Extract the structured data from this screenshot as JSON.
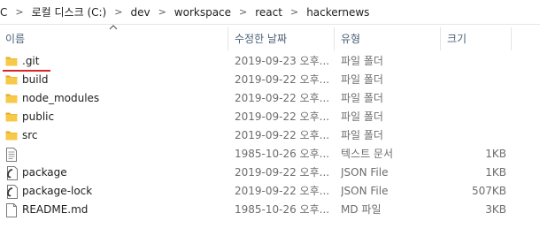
{
  "breadcrumb": {
    "lead_char": "C",
    "items": [
      "로컬 디스크 (C:)",
      "dev",
      "workspace",
      "react",
      "hackernews"
    ],
    "separator": ">"
  },
  "columns": {
    "name": "이름",
    "date": "수정한 날짜",
    "type": "유형",
    "size": "크기"
  },
  "files": [
    {
      "name": ".git",
      "date": "2019-09-23 오후...",
      "type": "파일 폴더",
      "size": "",
      "icon": "folder-icon"
    },
    {
      "name": "build",
      "date": "2019-09-22 오후...",
      "type": "파일 폴더",
      "size": "",
      "icon": "folder-icon"
    },
    {
      "name": "node_modules",
      "date": "2019-09-22 오후...",
      "type": "파일 폴더",
      "size": "",
      "icon": "folder-icon"
    },
    {
      "name": "public",
      "date": "2019-09-22 오후...",
      "type": "파일 폴더",
      "size": "",
      "icon": "folder-icon"
    },
    {
      "name": "src",
      "date": "2019-09-22 오후...",
      "type": "파일 폴더",
      "size": "",
      "icon": "folder-icon"
    },
    {
      "name": "",
      "date": "1985-10-26 오후...",
      "type": "텍스트 문서",
      "size": "1KB",
      "icon": "text-document-icon"
    },
    {
      "name": "package",
      "date": "2019-09-22 오후...",
      "type": "JSON File",
      "size": "1KB",
      "icon": "json-file-icon"
    },
    {
      "name": "package-lock",
      "date": "2019-09-22 오후...",
      "type": "JSON File",
      "size": "507KB",
      "icon": "json-file-icon"
    },
    {
      "name": "README.md",
      "date": "1985-10-26 오후...",
      "type": "MD 파일",
      "size": "3KB",
      "icon": "file-icon"
    }
  ],
  "colors": {
    "folder": "#f7c948",
    "folder_dark": "#e3a92a",
    "annotation": "#d9262b",
    "header_text": "#4c607a"
  }
}
